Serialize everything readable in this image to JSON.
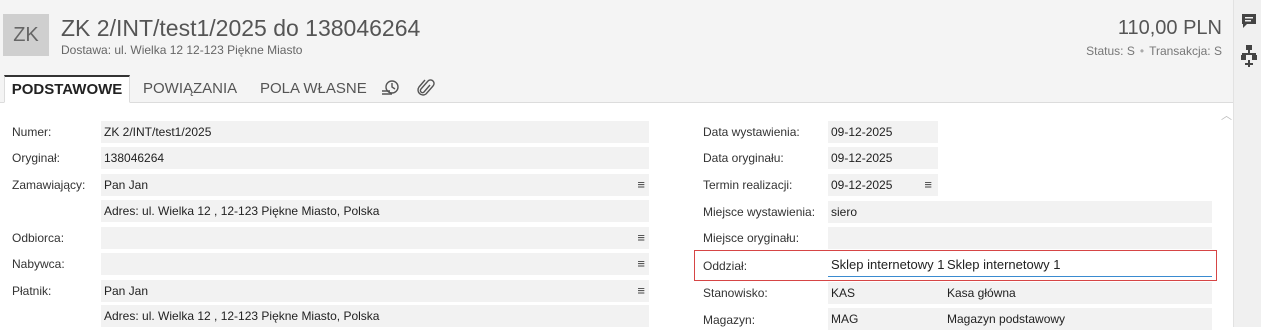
{
  "header": {
    "badge": "ZK",
    "title": "ZK 2/INT/test1/2025 do 138046264",
    "subtitle": "Dostawa: ul. Wielka 12 12-123 Piękne Miasto",
    "amount": "110,00 PLN",
    "status_label": "Status:",
    "status_value": "S",
    "transaction_label": "Transakcja:",
    "transaction_value": "S"
  },
  "tabs": [
    {
      "label": "PODSTAWOWE"
    },
    {
      "label": "POWIĄZANIA"
    },
    {
      "label": "POLA WŁASNE"
    }
  ],
  "icons": {
    "history": "history-icon",
    "attachment": "paperclip-icon",
    "comments": "comment-icon",
    "tree": "tree-icon",
    "menu": "menu-icon"
  },
  "left": {
    "numer": {
      "label": "Numer:",
      "value": "ZK 2/INT/test1/2025"
    },
    "oryginal": {
      "label": "Oryginał:",
      "value": "138046264"
    },
    "zamawiajacy": {
      "label": "Zamawiający:",
      "value": "Pan Jan",
      "address": "Adres:  ul. Wielka 12 , 12-123 Piękne Miasto, Polska"
    },
    "odbiorca": {
      "label": "Odbiorca:",
      "value": ""
    },
    "nabywca": {
      "label": "Nabywca:",
      "value": ""
    },
    "platnik": {
      "label": "Płatnik:",
      "value": "Pan Jan",
      "address": "Adres:  ul. Wielka 12 , 12-123 Piękne Miasto, Polska"
    }
  },
  "right": {
    "data_wystawienia": {
      "label": "Data wystawienia:",
      "value": "09-12-2025"
    },
    "data_oryginalu": {
      "label": "Data oryginału:",
      "value": "09-12-2025"
    },
    "termin_realizacji": {
      "label": "Termin realizacji:",
      "value": "09-12-2025"
    },
    "miejsce_wystawienia": {
      "label": "Miejsce wystawienia:",
      "value": "siero"
    },
    "miejsce_oryginalu": {
      "label": "Miejsce oryginału:",
      "value": ""
    },
    "oddzial": {
      "label": "Oddział:",
      "code": "Sklep internetowy 1",
      "name": "Sklep internetowy 1"
    },
    "stanowisko": {
      "label": "Stanowisko:",
      "code": "KAS",
      "name": "Kasa główna"
    },
    "magazyn": {
      "label": "Magazyn:",
      "code": "MAG",
      "name": "Magazyn podstawowy"
    }
  },
  "colors": {
    "accent": "#3a8bd0",
    "highlight_border": "#d64545",
    "header_bg": "#f4f4f4"
  }
}
